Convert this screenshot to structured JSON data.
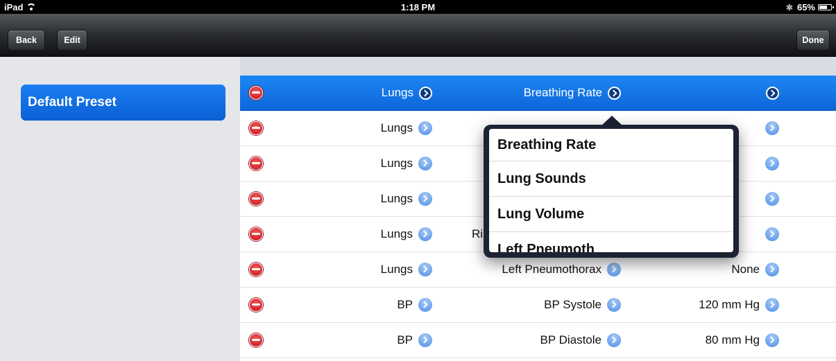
{
  "status_bar": {
    "device": "iPad",
    "time": "1:18 PM",
    "battery": "65%"
  },
  "navbar": {
    "back_label": "Back",
    "edit_label": "Edit",
    "done_label": "Done"
  },
  "sidebar": {
    "presets": [
      {
        "label": "Default Preset",
        "selected": true
      }
    ]
  },
  "rows": [
    {
      "system": "Lungs",
      "parameter": "Breathing Rate",
      "value": "",
      "selected": true
    },
    {
      "system": "Lungs",
      "parameter": "",
      "value": ""
    },
    {
      "system": "Lungs",
      "parameter": "",
      "value": ""
    },
    {
      "system": "Lungs",
      "parameter": "",
      "value": ""
    },
    {
      "system": "Lungs",
      "parameter": "Ri",
      "value": ""
    },
    {
      "system": "Lungs",
      "parameter": "Left Pneumothorax",
      "value": "None"
    },
    {
      "system": "BP",
      "parameter": "BP Systole",
      "value": "120 mm Hg"
    },
    {
      "system": "BP",
      "parameter": "BP Diastole",
      "value": "80 mm Hg"
    }
  ],
  "popover": {
    "options": [
      "Breathing Rate",
      "Lung Sounds",
      "Lung Volume",
      "Left Pneumoth"
    ]
  },
  "colors": {
    "selection_blue": "#1c86f3",
    "delete_red": "#d0141e",
    "disclosure_blue": "#4e8ee8"
  }
}
